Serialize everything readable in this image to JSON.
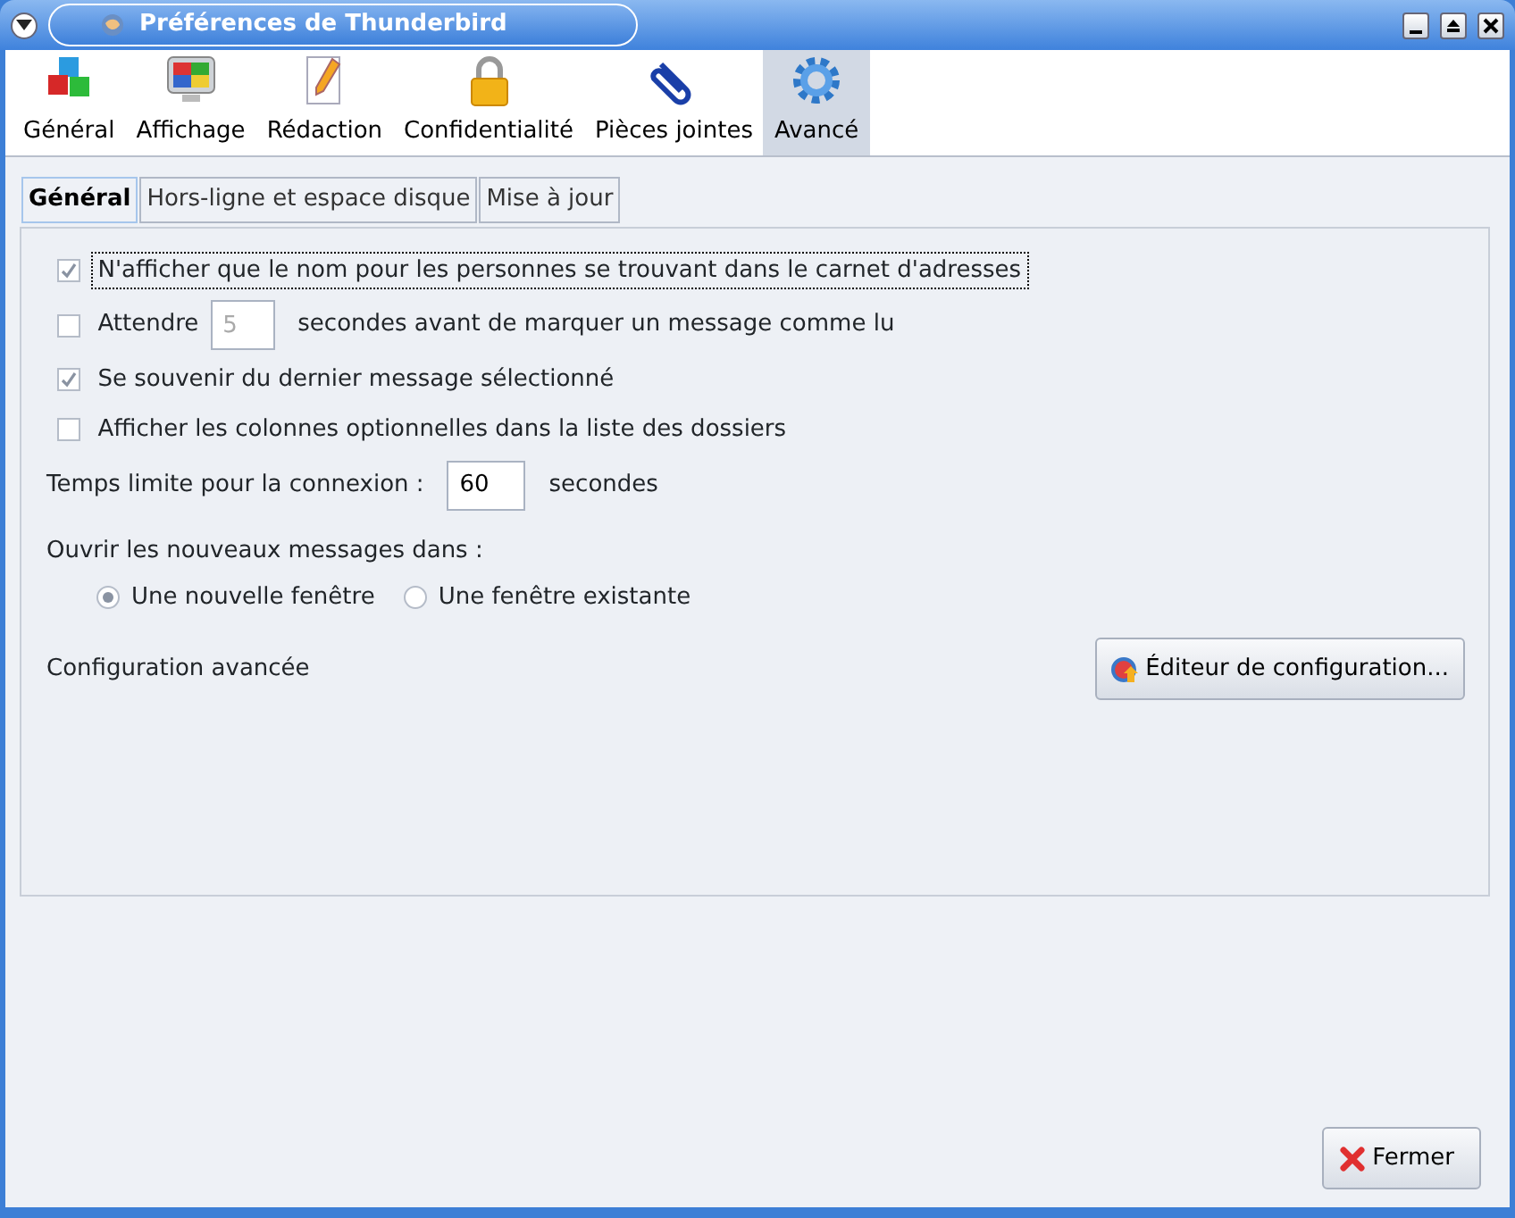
{
  "window": {
    "title": "Préférences de Thunderbird"
  },
  "toolbar": [
    {
      "label": "Général",
      "selected": false
    },
    {
      "label": "Affichage",
      "selected": false
    },
    {
      "label": "Rédaction",
      "selected": false
    },
    {
      "label": "Confidentialité",
      "selected": false
    },
    {
      "label": "Pièces jointes",
      "selected": false
    },
    {
      "label": "Avancé",
      "selected": true
    }
  ],
  "subtabs": [
    {
      "label": "Général",
      "selected": true
    },
    {
      "label": "Hors-ligne et espace disque",
      "selected": false
    },
    {
      "label": "Mise à jour",
      "selected": false
    }
  ],
  "options": [
    {
      "kind": "checkbox",
      "label": "N'afficher que le nom pour les personnes se trouvant dans le carnet d'adresses",
      "checked": true,
      "focused": true
    },
    {
      "kind": "checkbox_field",
      "label": "Attendre",
      "checked": false,
      "value": "5",
      "disabled": true,
      "suffix": "secondes avant de marquer un message comme lu"
    },
    {
      "kind": "checkbox",
      "label": "Se souvenir du dernier message sélectionné",
      "checked": true,
      "focused": false
    },
    {
      "kind": "checkbox",
      "label": "Afficher les colonnes optionnelles dans la liste des dossiers",
      "checked": false,
      "focused": false
    }
  ],
  "timeout": {
    "label": "Temps limite pour la connexion :",
    "value": "60",
    "suffix": "secondes"
  },
  "open_new": {
    "label": "Ouvrir les nouveaux messages dans :",
    "options": [
      {
        "label": "Une nouvelle fenêtre",
        "selected": true
      },
      {
        "label": "Une fenêtre existante",
        "selected": false
      }
    ]
  },
  "advanced": {
    "label": "Configuration avancée",
    "button": "Éditeur de configuration..."
  },
  "close_button": "Fermer"
}
